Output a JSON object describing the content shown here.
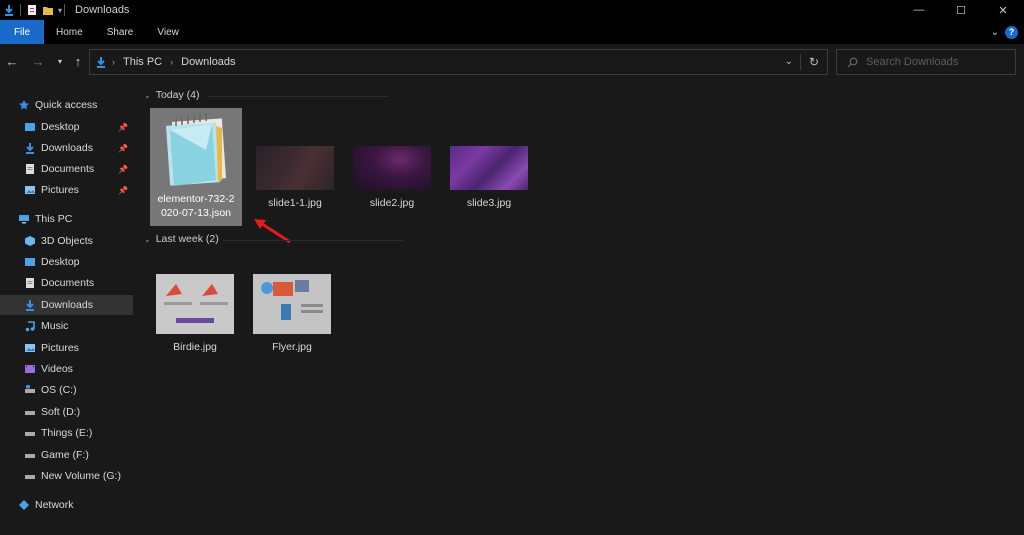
{
  "window": {
    "title": "Downloads",
    "controls": {
      "minimize": "—",
      "maximize": "☐",
      "close": "✕"
    }
  },
  "ribbon": {
    "tabs": [
      "File",
      "Home",
      "Share",
      "View"
    ],
    "help": "?"
  },
  "address": {
    "crumbs": [
      "This PC",
      "Downloads"
    ],
    "search_placeholder": "Search Downloads"
  },
  "nav": {
    "items": [
      {
        "label": "Quick access",
        "icon": "star-icon"
      },
      {
        "label": "Desktop",
        "icon": "desktop-folder-icon",
        "pinned": true
      },
      {
        "label": "Downloads",
        "icon": "download-arrow-icon",
        "pinned": true
      },
      {
        "label": "Documents",
        "icon": "documents-icon",
        "pinned": true
      },
      {
        "label": "Pictures",
        "icon": "pictures-icon",
        "pinned": true
      },
      {
        "label": "This PC",
        "icon": "computer-icon"
      },
      {
        "label": "3D Objects",
        "icon": "cube-icon"
      },
      {
        "label": "Desktop",
        "icon": "desktop-folder-icon"
      },
      {
        "label": "Documents",
        "icon": "documents-icon"
      },
      {
        "label": "Downloads",
        "icon": "download-arrow-icon",
        "selected": true
      },
      {
        "label": "Music",
        "icon": "music-icon"
      },
      {
        "label": "Pictures",
        "icon": "pictures-icon"
      },
      {
        "label": "Videos",
        "icon": "videos-icon"
      },
      {
        "label": "OS (C:)",
        "icon": "drive-icon"
      },
      {
        "label": "Soft (D:)",
        "icon": "drive-icon"
      },
      {
        "label": "Things (E:)",
        "icon": "drive-icon"
      },
      {
        "label": "Game (F:)",
        "icon": "drive-icon"
      },
      {
        "label": "New Volume (G:)",
        "icon": "drive-icon"
      },
      {
        "label": "Network",
        "icon": "network-icon"
      }
    ]
  },
  "groups": [
    {
      "header": "Today (4)",
      "files": [
        {
          "name_line1": "elementor-732-2",
          "name_line2": "020-07-13.json",
          "icon": "notepad-icon",
          "selected": true
        },
        {
          "name_line1": "slide1-1.jpg",
          "icon": "image-thumbnail-icon"
        },
        {
          "name_line1": "slide2.jpg",
          "icon": "image-thumbnail-icon"
        },
        {
          "name_line1": "slide3.jpg",
          "icon": "image-thumbnail-icon"
        }
      ]
    },
    {
      "header": "Last week (2)",
      "files": [
        {
          "name_line1": "Birdie.jpg",
          "icon": "image-thumbnail-icon"
        },
        {
          "name_line1": "Flyer.jpg",
          "icon": "image-thumbnail-icon"
        }
      ]
    }
  ],
  "colors": {
    "accent": "#1a6ac9",
    "arrow": "#e21b1b"
  }
}
